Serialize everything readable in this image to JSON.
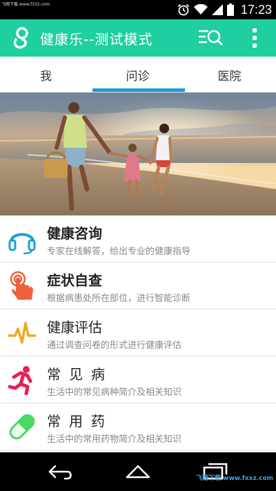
{
  "status_bar": {
    "watermark": "飞翔下载 www.f332.com",
    "time": "17:23"
  },
  "app_bar": {
    "title": "健康乐--测试模式",
    "brand_color": "#1fcfa0"
  },
  "tabs": [
    {
      "label": "我",
      "selected": false
    },
    {
      "label": "问诊",
      "selected": true
    },
    {
      "label": "医院",
      "selected": false
    }
  ],
  "tab_indicator_color": "#1a9fd6",
  "list": [
    {
      "title": "健康咨询",
      "subtitle": "专家在线解答，给出专业的健康指导",
      "icon": "headset-icon",
      "color": "#1a9fd6"
    },
    {
      "title": "症状自查",
      "subtitle": "根据病患处所在部位，进行智能诊断",
      "icon": "touch-hand-icon",
      "color": "#f0603c"
    },
    {
      "title": "健康评估",
      "subtitle": "通过调查问卷的形式进行健康评估",
      "icon": "heartbeat-icon",
      "color": "#f2a81d"
    },
    {
      "title": "常见病",
      "subtitle": "生活中的常见病种简介及相关知识",
      "icon": "running-person-icon",
      "color": "#e8214e"
    },
    {
      "title": "常用药",
      "subtitle": "生活中的常用药物简介及相关知识",
      "icon": "pill-icon",
      "color": "#4cd964"
    }
  ],
  "nav_bar": {
    "watermark": "飞翔下载 www.fxxz.com"
  }
}
